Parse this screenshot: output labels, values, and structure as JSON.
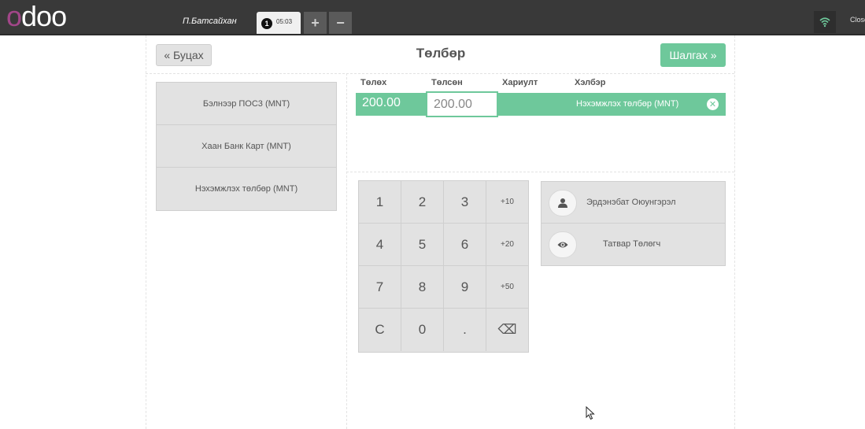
{
  "header": {
    "logo": "odoo",
    "cashier": "П.Батсайхан",
    "order": {
      "number": "1",
      "time": "05:03"
    },
    "add_order": "+",
    "remove_order": "−",
    "close_label": "Close"
  },
  "screen": {
    "back_label": "« Буцах",
    "title": "Төлбөр",
    "next_label": "Шалгах »"
  },
  "payment_methods": [
    {
      "label": "Бэлнээр ПОС3 (MNT)"
    },
    {
      "label": "Хаан Банк Карт (MNT)"
    },
    {
      "label": "Нэхэмжлэх төлбөр (MNT)"
    }
  ],
  "paymentlines": {
    "headers": {
      "due": "Төлөх",
      "tendered": "Төлсөн",
      "change": "Хариулт",
      "method": "Хэлбэр"
    },
    "lines": [
      {
        "due": "200.00",
        "tendered": "200.00",
        "method": "Нэхэмжлэх төлбөр (MNT)"
      }
    ]
  },
  "numpad": {
    "keys": [
      "1",
      "2",
      "3",
      "+10",
      "4",
      "5",
      "6",
      "+20",
      "7",
      "8",
      "9",
      "+50",
      "C",
      "0",
      ".",
      "⌫"
    ]
  },
  "customer": {
    "name": "Эрдэнэбат Оюунгэрэл",
    "tax_label": "Татвар Төлөгч"
  },
  "colors": {
    "topbar": "#393939",
    "accent_green": "#6ec89b",
    "logo_purple": "#a24689",
    "button_gray": "#e2e2e2"
  },
  "icons": {
    "wifi": "wifi-icon",
    "customer": "user-icon",
    "tax": "eye-icon",
    "delete_line": "times-circle-icon",
    "backspace": "backspace-icon"
  }
}
